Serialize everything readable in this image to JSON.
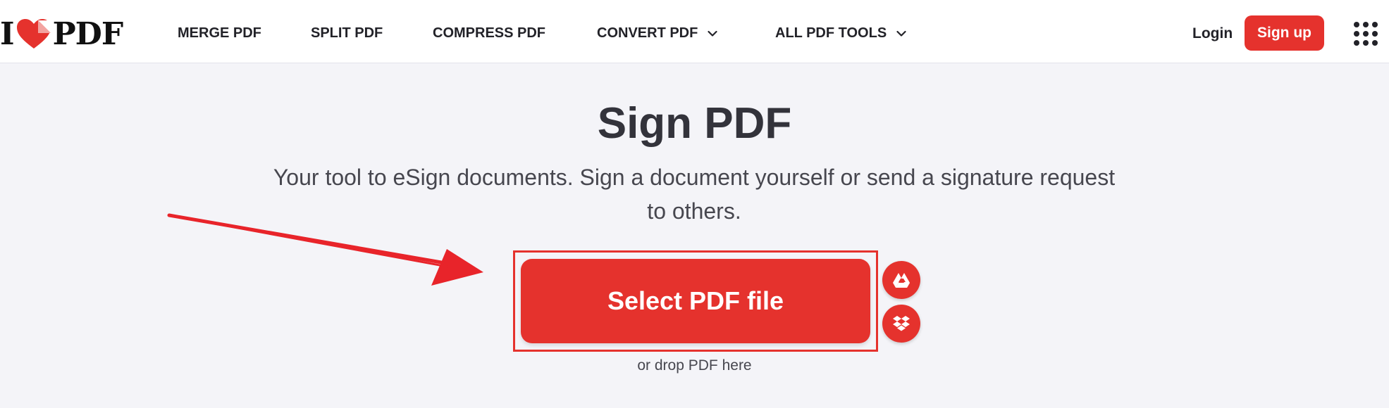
{
  "header": {
    "logo": {
      "text_left": "I",
      "text_right": "PDF"
    },
    "nav": [
      {
        "label": "MERGE PDF",
        "has_dropdown": false
      },
      {
        "label": "SPLIT PDF",
        "has_dropdown": false
      },
      {
        "label": "COMPRESS PDF",
        "has_dropdown": false
      },
      {
        "label": "CONVERT PDF",
        "has_dropdown": true
      },
      {
        "label": "ALL PDF TOOLS",
        "has_dropdown": true
      }
    ],
    "login_label": "Login",
    "signup_label": "Sign up",
    "apps_icon": "apps-grid-icon"
  },
  "main": {
    "title": "Sign PDF",
    "subtitle": "Your tool to eSign documents. Sign a document yourself or send a signature request to others.",
    "select_button_label": "Select PDF file",
    "cloud_sources": [
      {
        "icon": "google-drive-icon"
      },
      {
        "icon": "dropbox-icon"
      }
    ],
    "drop_hint": "or drop PDF here"
  },
  "colors": {
    "brand_red": "#e5322d",
    "annotation_red": "#e8242a",
    "background": "#f4f4f8",
    "text_dark": "#33333b"
  }
}
